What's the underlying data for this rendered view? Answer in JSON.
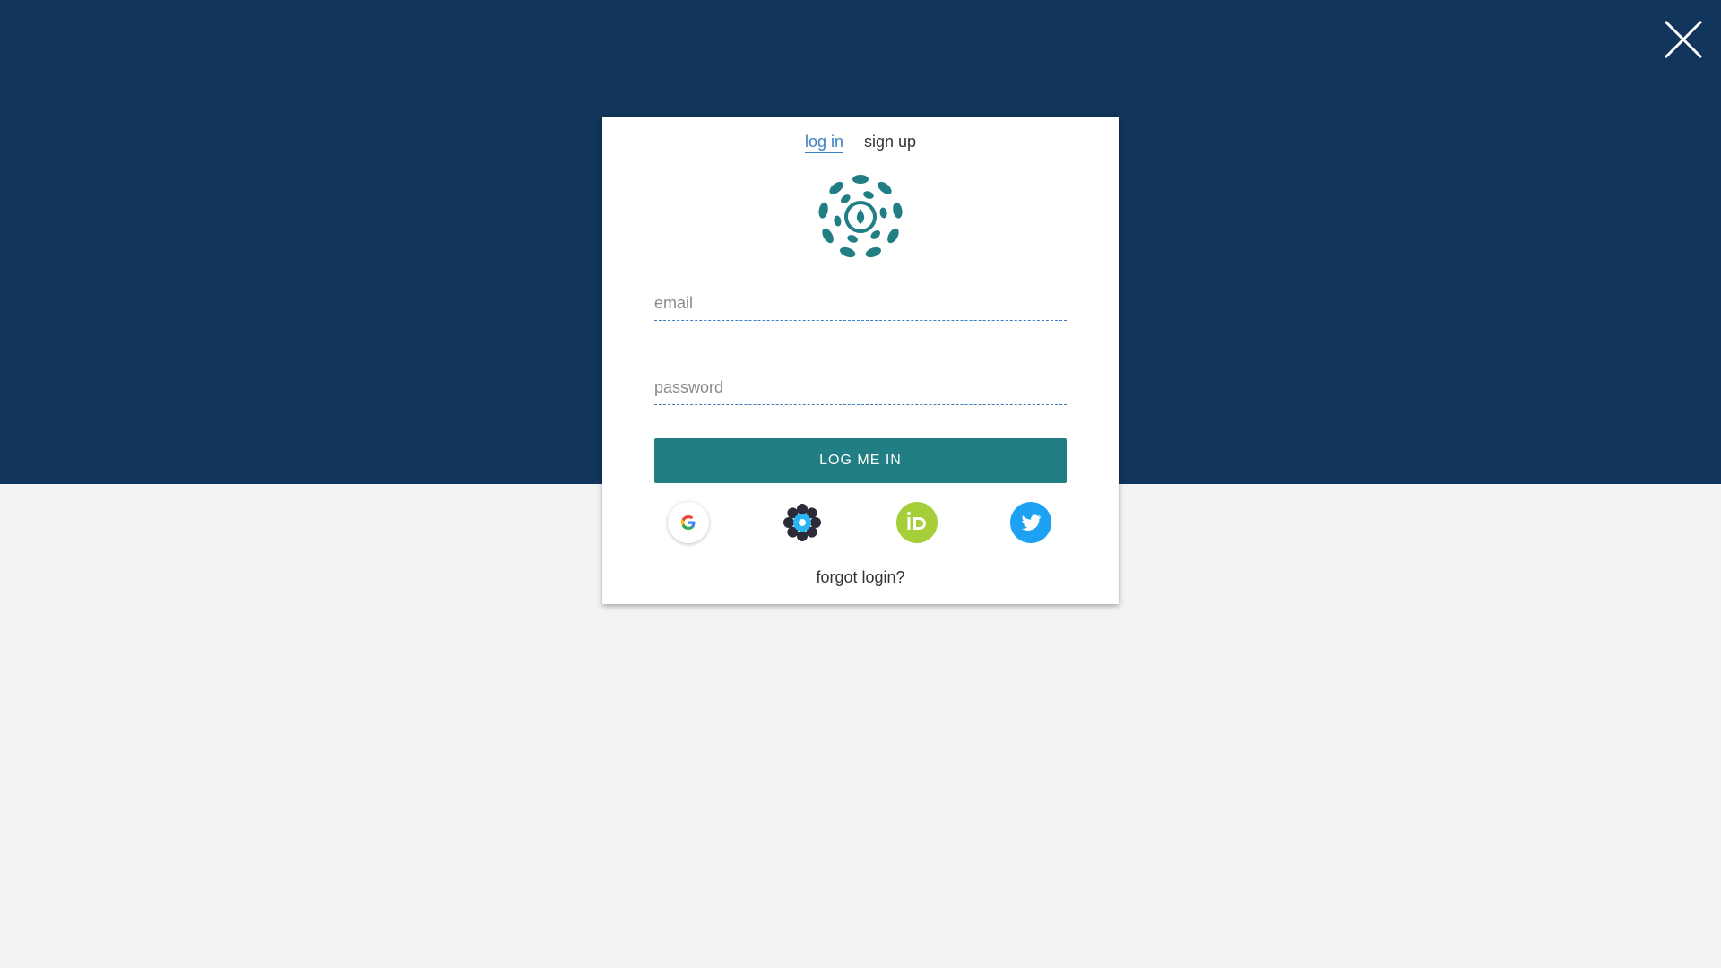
{
  "colors": {
    "header_background": "#12355b",
    "page_background": "#f2f3f5",
    "accent": "#207e84",
    "link_active": "#3a7fc4",
    "orcid_green": "#a6ce39",
    "twitter_blue": "#1da1f2"
  },
  "close": {
    "icon": "close-icon"
  },
  "auth_tabs": {
    "login_label": "log in",
    "signup_label": "sign up"
  },
  "logo": {
    "icon": "protocols-flower-logo"
  },
  "form": {
    "email_placeholder": "email",
    "password_placeholder": "password",
    "submit_label": "LOG ME IN"
  },
  "social_providers": [
    {
      "name": "google",
      "icon": "google-icon"
    },
    {
      "name": "flower",
      "icon": "flower-icon"
    },
    {
      "name": "orcid",
      "icon": "orcid-icon"
    },
    {
      "name": "twitter",
      "icon": "twitter-icon"
    }
  ],
  "forgot_label": "forgot login?"
}
